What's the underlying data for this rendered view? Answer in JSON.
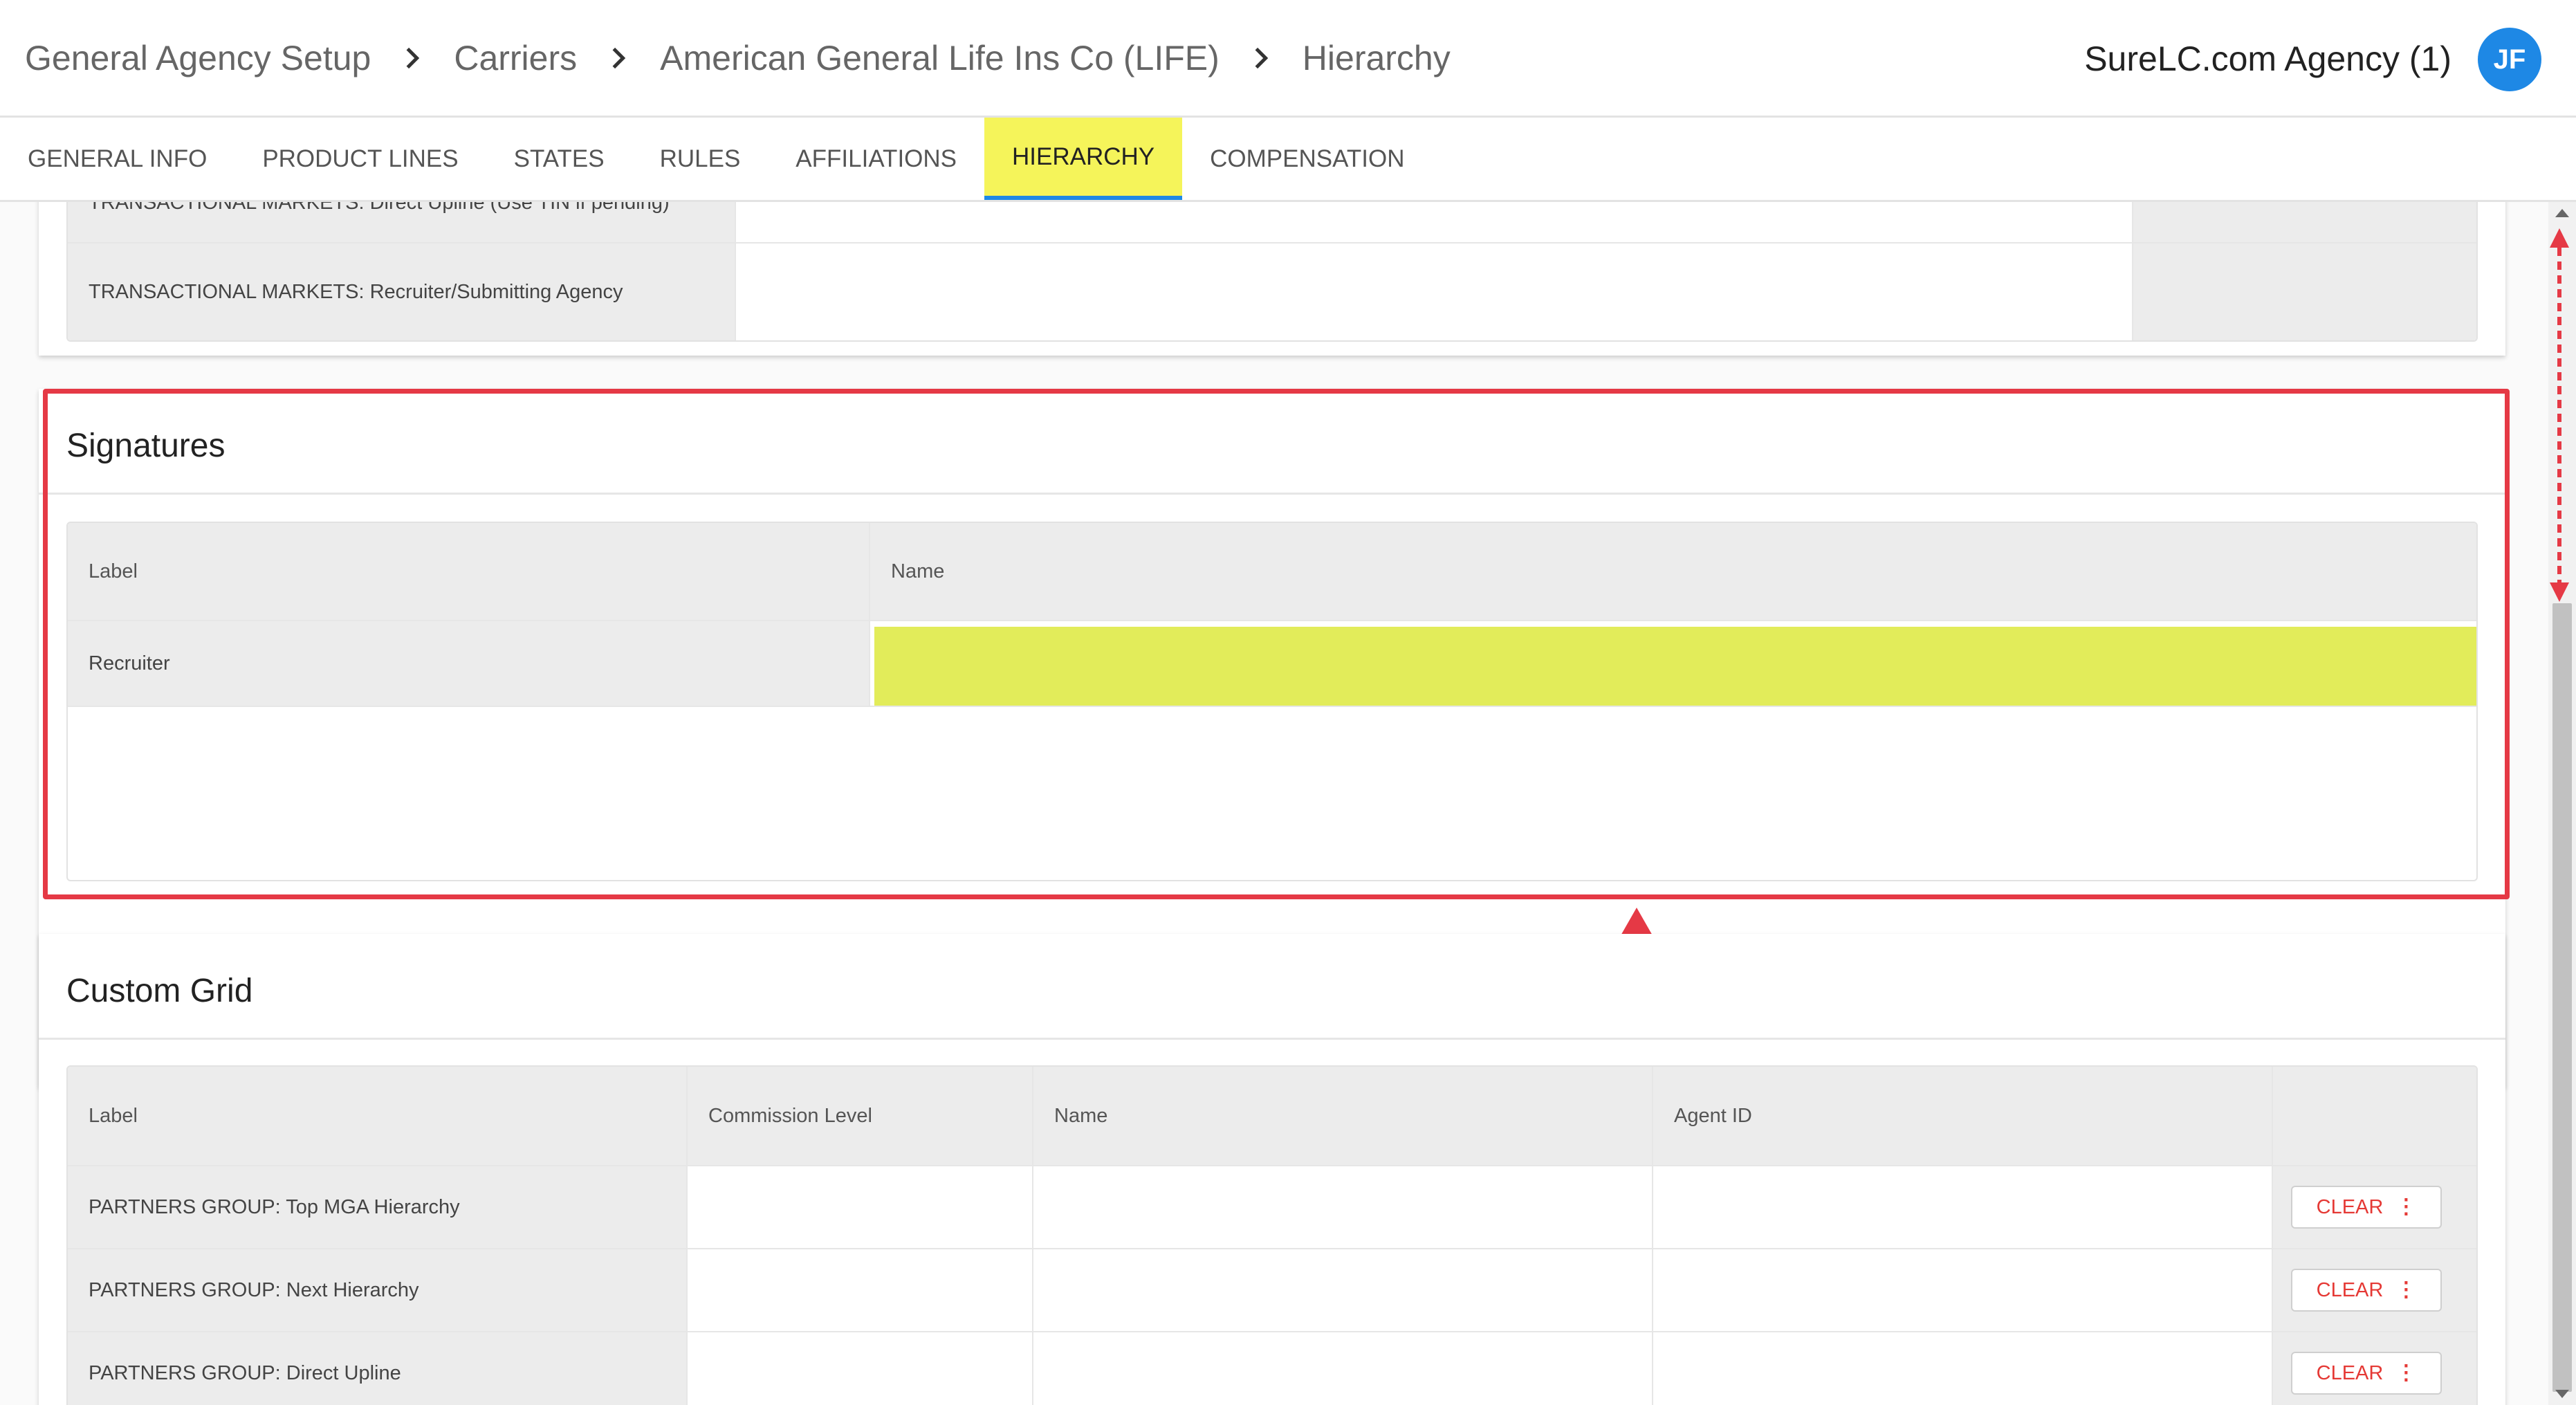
{
  "breadcrumb": [
    "General Agency Setup",
    "Carriers",
    "American General Life Ins Co (LIFE)",
    "Hierarchy"
  ],
  "agency_name": "SureLC.com Agency (1)",
  "avatar_initials": "JF",
  "tabs": [
    {
      "label": "GENERAL INFO",
      "active": false
    },
    {
      "label": "PRODUCT LINES",
      "active": false
    },
    {
      "label": "STATES",
      "active": false
    },
    {
      "label": "RULES",
      "active": false
    },
    {
      "label": "AFFILIATIONS",
      "active": false
    },
    {
      "label": "HIERARCHY",
      "active": true
    },
    {
      "label": "COMPENSATION",
      "active": false
    }
  ],
  "top_grid_rows": [
    "TRANSACTIONAL MARKETS: Direct Upline (Use TIN if pending)",
    "TRANSACTIONAL MARKETS: Recruiter/Submitting Agency"
  ],
  "signatures": {
    "title": "Signatures",
    "columns": [
      "Label",
      "Name"
    ],
    "rows": [
      {
        "label": "Recruiter",
        "name": ""
      }
    ]
  },
  "custom_grid": {
    "title": "Custom Grid",
    "columns": [
      "Label",
      "Commission Level",
      "Name",
      "Agent ID"
    ],
    "rows": [
      {
        "label": "PARTNERS GROUP: Top MGA Hierarchy",
        "commission_level": "",
        "name": "",
        "agent_id": ""
      },
      {
        "label": "PARTNERS GROUP: Next Hierarchy",
        "commission_level": "",
        "name": "",
        "agent_id": ""
      },
      {
        "label": "PARTNERS GROUP: Direct Upline",
        "commission_level": "",
        "name": "",
        "agent_id": ""
      }
    ],
    "clear_label": "CLEAR",
    "more_icon": "more-vertical-icon"
  },
  "colors": {
    "accent": "#1e88e5",
    "active_tab_highlight": "#f5f45a",
    "field_highlight": "#e2ec5a",
    "annotation_red": "#e53945",
    "clear_text": "#e53935"
  }
}
